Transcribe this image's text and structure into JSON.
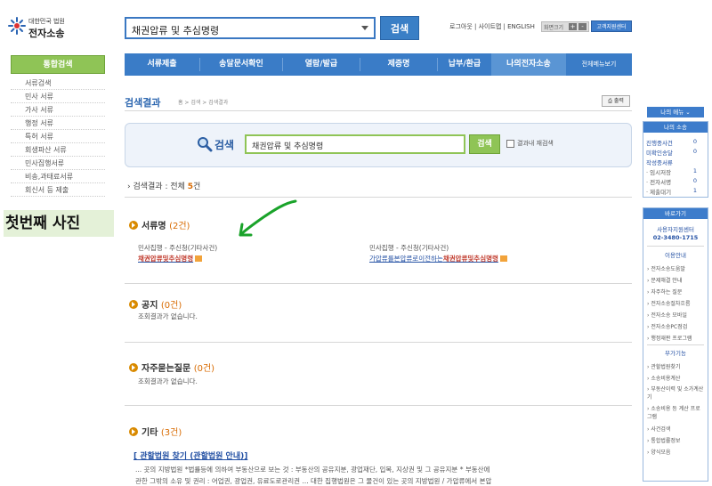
{
  "header": {
    "logo_line1": "대한민국 법원",
    "logo_line2": "전자소송",
    "search_value": "채권압류 및 추심명령",
    "search_button": "검색",
    "util_links": "로그아웃 | 사이트맵 | ENGLISH",
    "font_size_label": "화면크기",
    "font_plus": "+",
    "font_minus": "-",
    "help_button": "고객지원센터"
  },
  "nav": {
    "items": [
      "서류제출",
      "송달문서확인",
      "열람/발급",
      "제증명",
      "납부/환급",
      "나의전자소송",
      "전체메뉴보기"
    ]
  },
  "sidebar": {
    "title": "통합검색",
    "items": [
      "서류검색",
      "민사 서류",
      "가사 서류",
      "행정 서류",
      "특허 서류",
      "회생파산 서류",
      "민사집행서류",
      "비송,과태료서류",
      "회신서 등 제출"
    ]
  },
  "photo_label": "첫번째 사진",
  "results": {
    "title": "검색결과",
    "breadcrumb": "홈 > 검색 > 검색결과",
    "print": "출력",
    "search_label": "검색",
    "search_value": "채권압류 및 추심명령",
    "search_button": "검색",
    "research_label": "결과내 재검색",
    "summary_prefix": "검색결과 : 전체 ",
    "summary_count": "5",
    "summary_suffix": "건"
  },
  "sections": {
    "docs": {
      "name": "서류명",
      "count_text": "(2건)",
      "items": [
        {
          "meta": "민사집행 - 주신청(기타사건)",
          "link_plain": "",
          "link_highlight": "채권압류및추심명령"
        },
        {
          "meta": "민사집행 - 주신청(기타사건)",
          "link_plain": "가압류를본압류로이전하는",
          "link_highlight": "채권압류및추심명령"
        }
      ]
    },
    "notice": {
      "name": "공지",
      "count_text": "(0건)",
      "empty": "조회결과가 없습니다."
    },
    "faq": {
      "name": "자주묻는질문",
      "count_text": "(0건)",
      "empty": "조회결과가 없습니다."
    },
    "etc": {
      "name": "기타",
      "count_text": "(3건)",
      "link": "[ 관할법원 찾기 (관할법원 안내)]",
      "desc": "... 곳의 지방법원 *법률등에 의하여 부동산으로 보는 것 : 부동산의 공유지분, 광업재단, 입목, 지상권 및 그 공유지분 * 부동산에",
      "desc2": "관한 그밖의 소유 및 권리 : 어업권, 광업권, 유료도로관리권 ... 대한 집행법원은 그 물건이 있는 곳의 지방법원 / 가압류에서 본압"
    }
  },
  "right": {
    "menu_button": "나의 메뉴",
    "litigation": {
      "title": "나의 소송",
      "rows": [
        {
          "label": "진행중사건",
          "num": "0"
        },
        {
          "label": "미확인송달",
          "num": "0"
        },
        {
          "label": "작성중서류",
          "num": ""
        },
        {
          "label": "· 임시저장",
          "num": "1"
        },
        {
          "label": "· 전자서명",
          "num": "0"
        },
        {
          "label": "· 제출대기",
          "num": "1"
        }
      ]
    },
    "goto": {
      "title": "바로가기",
      "center": "사용자지원센터",
      "phone": "02-3480-1715",
      "guide": "이용안내",
      "links": [
        "전자소송도움말",
        "문제해결 안내",
        "자주하는 질문",
        "전자소송절차흐름",
        "전자소송 모바일",
        "전자소송PC점검",
        "행정재판 프로그램"
      ],
      "extra": "부가기능",
      "links2": [
        "관할법원찾기",
        "소송비용계산",
        "부동산이력 및 소가계산기",
        "소송비용 등 계산 프로그램",
        "사건검색",
        "통합법률정보",
        "양식모음"
      ]
    }
  },
  "colors": {
    "accent": "#3a7cc7",
    "green": "#8fc456",
    "orange": "#d86a00",
    "highlight": "#c0392b"
  }
}
